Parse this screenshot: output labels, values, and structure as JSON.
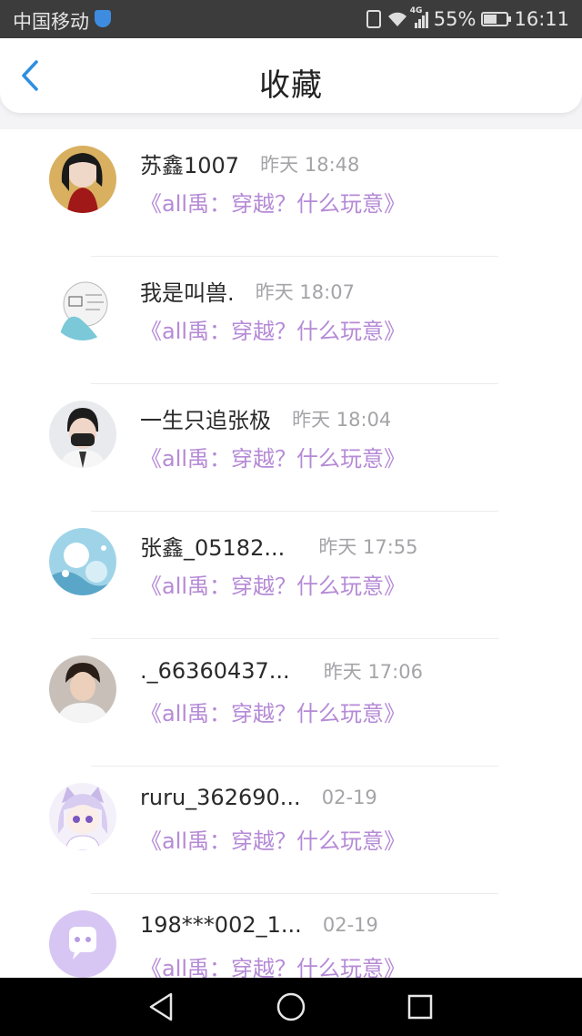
{
  "status_bar": {
    "carrier": "中国移动",
    "network": "4G",
    "battery": "55%",
    "time": "16:11"
  },
  "header": {
    "title": "收藏",
    "back_icon": "chevron-left-icon",
    "accent_color": "#2f8fe0"
  },
  "list": {
    "items": [
      {
        "user": "苏鑫1007",
        "time": "昨天 18:48",
        "work": "《all禹：穿越？什么玩意》",
        "avatar": "anime-girl-avatar"
      },
      {
        "user": "我是叫兽.",
        "time": "昨天 18:07",
        "work": "《all禹：穿越？什么玩意》",
        "avatar": "sketch-avatar"
      },
      {
        "user": "一生只追张极",
        "time": "昨天 18:04",
        "work": "《all禹：穿越？什么玩意》",
        "avatar": "boy-mask-avatar"
      },
      {
        "user": "张鑫_05182...",
        "time": "昨天 17:55",
        "work": "《all禹：穿越？什么玩意》",
        "avatar": "blue-flower-avatar"
      },
      {
        "user": "._66360437...",
        "time": "昨天 17:06",
        "work": "《all禹：穿越？什么玩意》",
        "avatar": "boy-photo-avatar"
      },
      {
        "user": "ruru_362690...",
        "time": "02-19",
        "work": "《all禹：穿越？什么玩意》",
        "avatar": "cat-girl-avatar"
      },
      {
        "user": "198***002_1...",
        "time": "02-19",
        "work": "《all禹：穿越？什么玩意》",
        "avatar": "default-chat-avatar"
      }
    ],
    "work_color": "#b58ad6"
  },
  "nav_bar": {
    "back_icon": "triangle-back-icon",
    "home_icon": "circle-home-icon",
    "recent_icon": "square-recents-icon"
  }
}
